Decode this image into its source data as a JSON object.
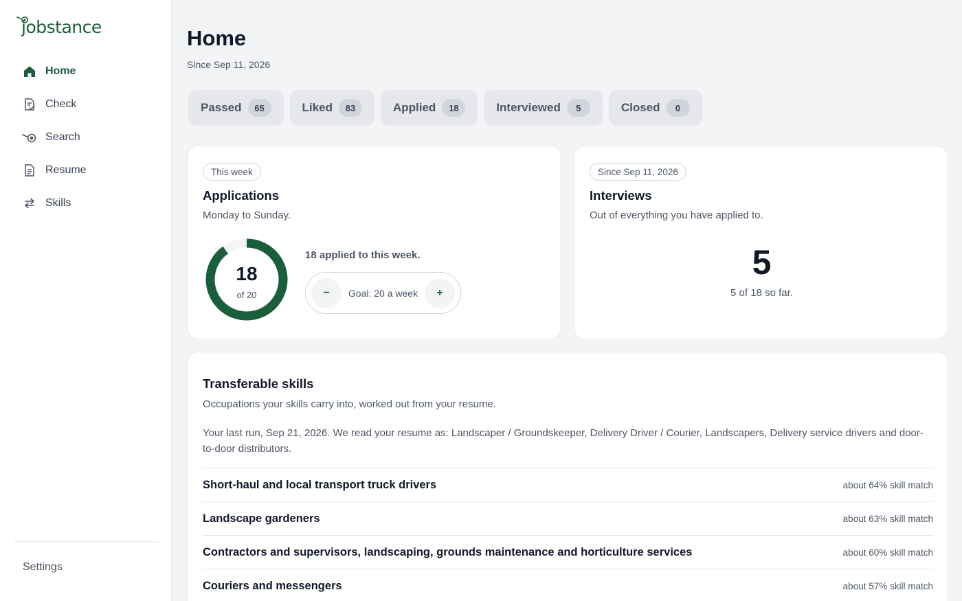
{
  "app": {
    "name": "jobstance"
  },
  "sidebar": {
    "items": [
      {
        "label": "Home",
        "icon": "home-icon",
        "active": true
      },
      {
        "label": "Check",
        "icon": "check-document-icon",
        "active": false
      },
      {
        "label": "Search",
        "icon": "search-target-icon",
        "active": false
      },
      {
        "label": "Resume",
        "icon": "resume-document-icon",
        "active": false
      },
      {
        "label": "Skills",
        "icon": "swap-arrows-icon",
        "active": false
      }
    ],
    "settings_label": "Settings"
  },
  "header": {
    "title": "Home",
    "subtitle": "Since Sep 11, 2026"
  },
  "statuses": [
    {
      "label": "Passed",
      "count": "65"
    },
    {
      "label": "Liked",
      "count": "83"
    },
    {
      "label": "Applied",
      "count": "18"
    },
    {
      "label": "Interviewed",
      "count": "5"
    },
    {
      "label": "Closed",
      "count": "0"
    }
  ],
  "applications_card": {
    "chip": "This week",
    "title": "Applications",
    "description": "Monday to Sunday.",
    "ring_value": "18",
    "ring_of": "of 20",
    "progress": 0.9,
    "applied_text": "18 applied to this week.",
    "goal_label": "Goal: 20 a week",
    "decrement": "−",
    "increment": "+"
  },
  "interviews_card": {
    "chip": "Since Sep 11, 2026",
    "title": "Interviews",
    "description": "Out of everything you have applied to.",
    "value": "5",
    "sub": "5 of 18 so far."
  },
  "skills_card": {
    "title": "Transferable skills",
    "description": "Occupations your skills carry into, worked out from your resume.",
    "last_run": "Your last run, Sep 21, 2026. We read your resume as: Landscaper / Groundskeeper, Delivery Driver / Courier, Landscapers, Delivery service drivers and door-to-door distributors.",
    "occupations": [
      {
        "name": "Short-haul and local transport truck drivers",
        "match": "about 64% skill match"
      },
      {
        "name": "Landscape gardeners",
        "match": "about 63% skill match"
      },
      {
        "name": "Contractors and supervisors, landscaping, grounds maintenance and horticulture services",
        "match": "about 60% skill match"
      },
      {
        "name": "Couriers and messengers",
        "match": "about 57% skill match"
      }
    ]
  },
  "colors": {
    "accent": "#1a5e3c",
    "ring_track": "#f3f4f6",
    "background": "#f3f4f6"
  }
}
